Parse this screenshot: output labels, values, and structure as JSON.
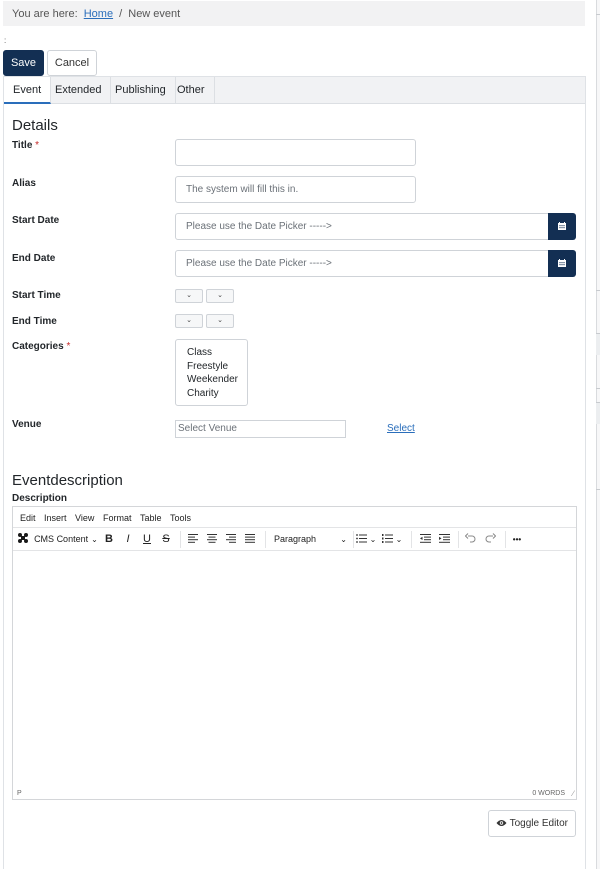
{
  "breadcrumb": {
    "prefix": "You are here:",
    "home": "Home",
    "separator": "/",
    "current": "New event"
  },
  "toolbar": {
    "save_label": "Save",
    "cancel_label": "Cancel"
  },
  "tabs": [
    {
      "label": "Event",
      "active": true
    },
    {
      "label": "Extended",
      "active": false
    },
    {
      "label": "Publishing",
      "active": false
    },
    {
      "label": "Other",
      "active": false
    }
  ],
  "details": {
    "heading": "Details",
    "title_label": "Title",
    "required_mark": "*",
    "title_value": "",
    "alias_label": "Alias",
    "alias_placeholder": "The system will fill this in.",
    "start_date_label": "Start Date",
    "start_date_placeholder": "Please use the Date Picker ----->",
    "end_date_label": "End Date",
    "end_date_placeholder": "Please use the Date Picker ----->",
    "start_time_label": "Start Time",
    "end_time_label": "End Time",
    "categories_label": "Categories",
    "categories": [
      "Class",
      "Freestyle",
      "Weekender",
      "Charity"
    ],
    "venue_label": "Venue",
    "venue_placeholder": "Select Venue",
    "venue_select": "Select"
  },
  "eventdescription": {
    "heading": "Eventdescription",
    "description_label": "Description"
  },
  "editor": {
    "menu": [
      "Edit",
      "Insert",
      "View",
      "Format",
      "Table",
      "Tools"
    ],
    "cms_content": "CMS Content",
    "bold": "B",
    "italic": "I",
    "underline": "U",
    "strikethrough": "S",
    "paragraph": "Paragraph",
    "more": "•••",
    "status_path": "P",
    "word_count": "0 WORDS",
    "toggle_label": "Toggle Editor"
  },
  "colors": {
    "primary": "#132f53",
    "link": "#2a6ebb",
    "required": "#c52827"
  },
  "icons": [
    "calendar-icon",
    "joomla-icon",
    "eye-icon",
    "chevron-down-icon"
  ]
}
